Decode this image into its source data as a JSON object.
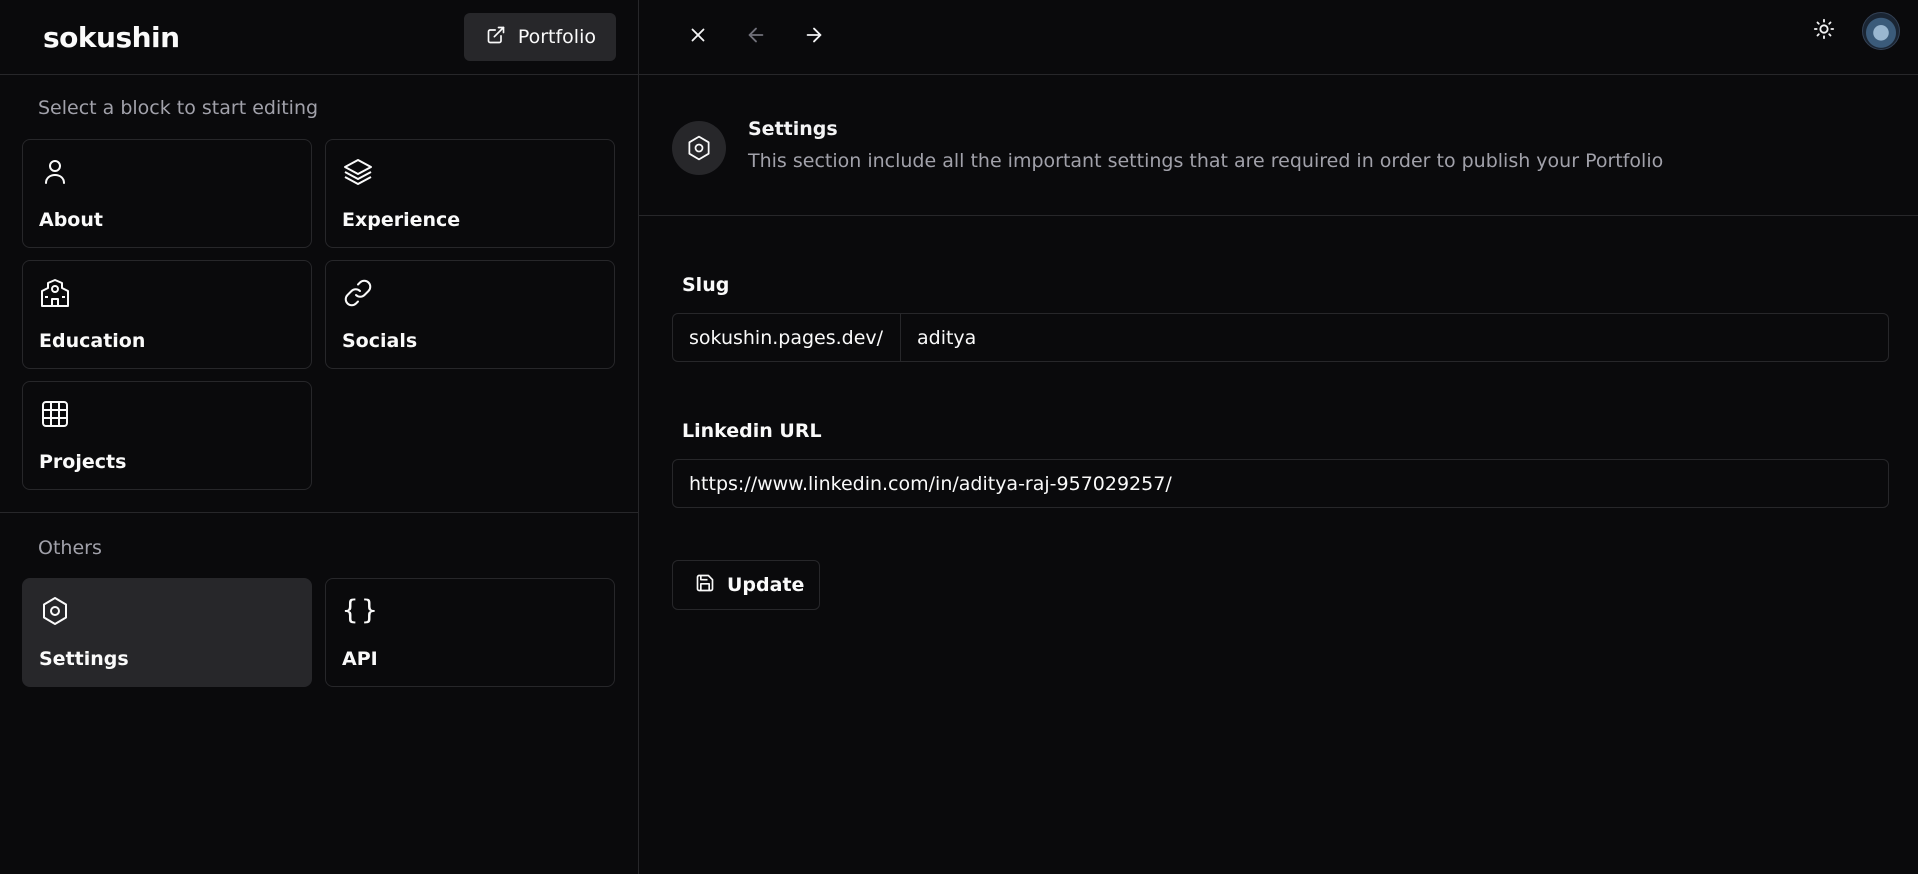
{
  "brand": "sokushin",
  "header": {
    "portfolio_label": "Portfolio"
  },
  "sidebar": {
    "section1_label": "Select a block to start editing",
    "section2_label": "Others",
    "blocks": [
      {
        "label": "About",
        "icon": "user-icon"
      },
      {
        "label": "Experience",
        "icon": "layers-icon"
      },
      {
        "label": "Education",
        "icon": "school-icon"
      },
      {
        "label": "Socials",
        "icon": "link-icon"
      },
      {
        "label": "Projects",
        "icon": "grid-icon"
      }
    ],
    "others": [
      {
        "label": "Settings",
        "icon": "hexagon-settings-icon",
        "active": true
      },
      {
        "label": "API",
        "icon": "braces-icon",
        "glyph": "{}"
      }
    ]
  },
  "topbar": {
    "icons": [
      "close-icon",
      "arrow-left-icon",
      "arrow-right-icon",
      "sun-icon",
      "avatar"
    ]
  },
  "settings": {
    "title": "Settings",
    "description": "This section include all the important settings that are required in order to publish your Portfolio",
    "slug_label": "Slug",
    "slug_prefix": "sokushin.pages.dev/",
    "slug_value": "aditya",
    "linkedin_label": "Linkedin URL",
    "linkedin_value": "https://www.linkedin.com/in/aditya-raj-957029257/",
    "update_label": "Update"
  },
  "colors": {
    "background": "#0a0a0c",
    "border": "#27272a",
    "active_tile": "#27272a",
    "muted_text": "#a1a1aa",
    "text": "#fafafa"
  }
}
